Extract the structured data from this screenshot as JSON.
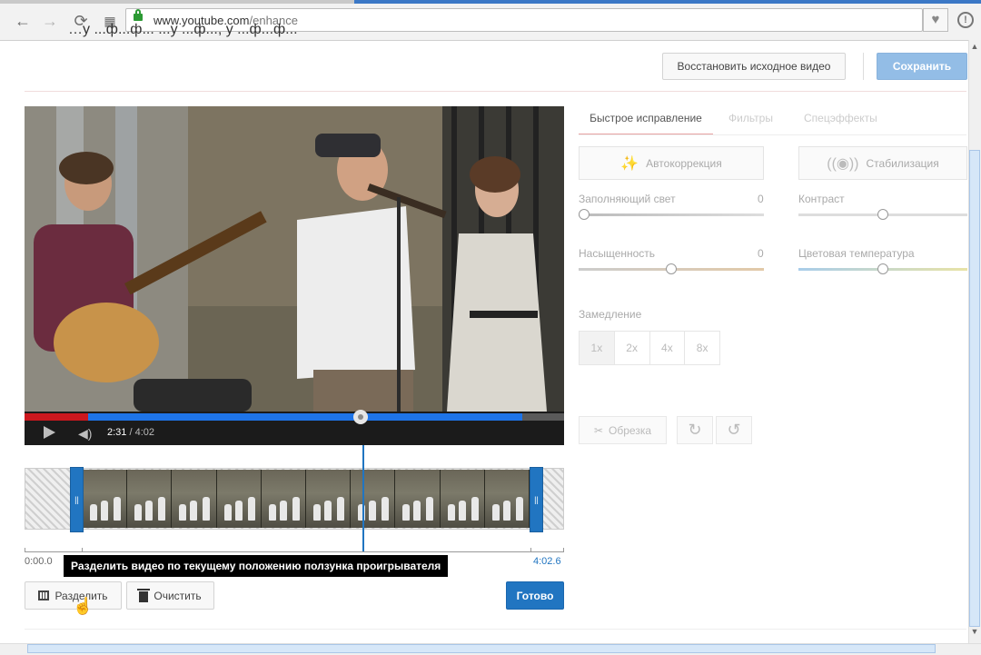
{
  "browser": {
    "url_host": "www.youtube.com",
    "url_path": "/enhance"
  },
  "header": {
    "cut_title": "…у ...ф...ф... ...у ...ф..., у ...ф...ф...",
    "restore_button": "Восстановить исходное видео",
    "save_button": "Сохранить"
  },
  "player": {
    "current_time": "2:31",
    "separator": " / ",
    "total_time": "4:02",
    "progress_fraction": 0.62
  },
  "timeline": {
    "start_label": "0:00.0",
    "end_label": "4:02.6",
    "tooltip": "Разделить видео по текущему положению ползунка проигрывателя",
    "split_button": "Разделить",
    "clear_button": "Очистить",
    "done_button": "Готово"
  },
  "panel": {
    "tabs": [
      "Быстрое исправление",
      "Фильтры",
      "Спецэффекты"
    ],
    "autocorrect_button": "Автокоррекция",
    "stabilize_button": "Стабилизация",
    "sliders": [
      {
        "label": "Заполняющий свет",
        "value": "0",
        "fraction": 0.0
      },
      {
        "label": "Контраст",
        "value": "",
        "fraction": 0.5
      },
      {
        "label": "Насыщенность",
        "value": "0",
        "fraction": 0.5
      },
      {
        "label": "Цветовая температура",
        "value": "",
        "fraction": 0.5
      }
    ],
    "slowdown_label": "Замедление",
    "speeds": [
      "1x",
      "2x",
      "4x",
      "8x"
    ],
    "selected_speed": "1x",
    "trim_button": "Обрезка"
  },
  "colors": {
    "accent_blue": "#2175c1",
    "save_blue": "#93bde6",
    "progress_red": "#cc181e"
  }
}
